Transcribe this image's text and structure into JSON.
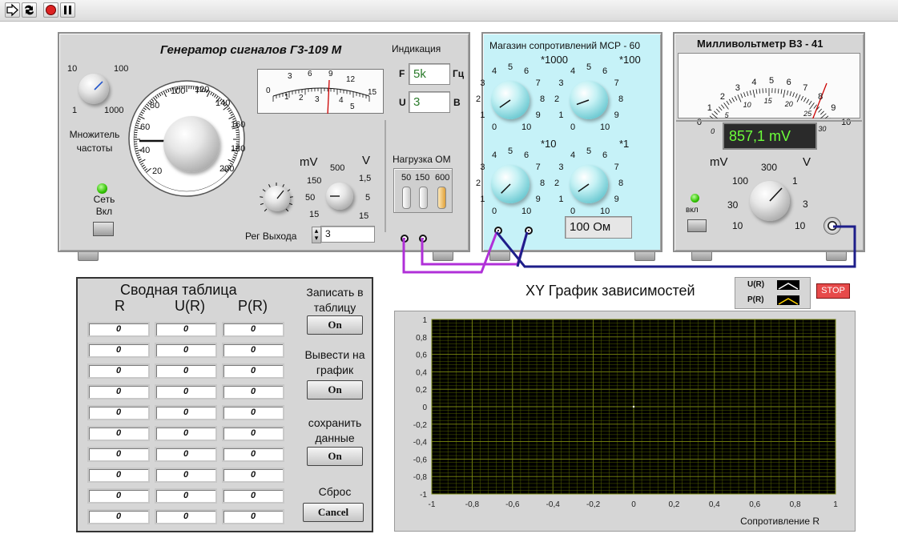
{
  "toolbar": {
    "icons": [
      "run-arrow-icon",
      "run-continuously-icon",
      "abort-icon",
      "pause-icon"
    ]
  },
  "generator": {
    "title": "Генератор сигналов Г3-109 М",
    "indication_label": "Индикация",
    "f_label": "F",
    "f_value": "5k",
    "f_unit": "Гц",
    "u_label": "U",
    "u_value": "3",
    "u_unit": "В",
    "multiplier_scale": [
      "10",
      "100",
      "1",
      "1000"
    ],
    "multiplier_label": "Множитель частоты",
    "dial_scale": [
      "20",
      "40",
      "60",
      "80",
      "100",
      "120",
      "140",
      "160",
      "180",
      "200"
    ],
    "power_label": "Сеть Вкл",
    "mv_label": "mV",
    "v_label": "V",
    "range_scale": [
      "500",
      "150",
      "50",
      "15",
      "1,5",
      "5",
      "15"
    ],
    "load_label": "Нагрузка ОМ",
    "load_options": [
      "50",
      "150",
      "600"
    ],
    "output_label": "Рег Выхода",
    "output_value": "3",
    "meter_top_scale": [
      "0",
      "3",
      "6",
      "9",
      "12"
    ],
    "meter_bottom_scale": [
      "0",
      "1",
      "2",
      "3",
      "4",
      "5",
      "15"
    ]
  },
  "resistance_box": {
    "title": "Магазин сопротивлений МСР - 60",
    "dials": [
      {
        "mult": "*1000"
      },
      {
        "mult": "*100"
      },
      {
        "mult": "*10"
      },
      {
        "mult": "*1"
      }
    ],
    "dial_scale": [
      "0",
      "1",
      "2",
      "3",
      "4",
      "5",
      "6",
      "7",
      "8",
      "9",
      "10"
    ],
    "value": "100 Ом"
  },
  "voltmeter": {
    "title": "Милливольтметр В3 - 41",
    "display": "857,1 mV",
    "mv_label": "mV",
    "v_label": "V",
    "range_scale": [
      "300",
      "100",
      "1",
      "30",
      "3",
      "10",
      "10"
    ],
    "power_label": "вкл",
    "meter_top_scale": [
      "0",
      "1",
      "2",
      "3",
      "4",
      "5",
      "6",
      "7",
      "8",
      "9",
      "10"
    ],
    "meter_bottom_scale": [
      "0",
      "5",
      "10",
      "15",
      "20",
      "25",
      "30"
    ]
  },
  "summary": {
    "title": "Сводная таблица",
    "columns": [
      "R",
      "U(R)",
      "P(R)"
    ],
    "rows": [
      [
        "0",
        "0",
        "0"
      ],
      [
        "0",
        "0",
        "0"
      ],
      [
        "0",
        "0",
        "0"
      ],
      [
        "0",
        "0",
        "0"
      ],
      [
        "0",
        "0",
        "0"
      ],
      [
        "0",
        "0",
        "0"
      ],
      [
        "0",
        "0",
        "0"
      ],
      [
        "0",
        "0",
        "0"
      ],
      [
        "0",
        "0",
        "0"
      ],
      [
        "0",
        "0",
        "0"
      ]
    ],
    "write_label": "Записать в таблицу",
    "write_btn": "On",
    "plot_label": "Вывести на график",
    "plot_btn": "On",
    "save_label": "сохранить данные",
    "save_btn": "On",
    "reset_label": "Сброс",
    "reset_btn": "Cancel"
  },
  "graph": {
    "title": "XY График зависимостей",
    "legend": [
      "U(R)",
      "P(R)"
    ],
    "stop_label": "STOP",
    "colors": {
      "plot_bg": "#000000",
      "grid": "#5a6a00",
      "grid_major": "#7c8a10",
      "ur_line": "#ffffff",
      "pr_line": "#ffd200"
    }
  },
  "chart_data": {
    "type": "scatter",
    "title": "XY График зависимостей",
    "xlabel": "Сопротивление R",
    "ylabel": "",
    "xlim": [
      -1,
      1
    ],
    "ylim": [
      -1,
      1
    ],
    "x_ticks": [
      "-1",
      "-0,8",
      "-0,6",
      "-0,4",
      "-0,2",
      "0",
      "0,2",
      "0,4",
      "0,6",
      "0,8",
      "1"
    ],
    "y_ticks": [
      "1",
      "0,8",
      "0,6",
      "0,4",
      "0,2",
      "0",
      "-0,2",
      "-0,4",
      "-0,6",
      "-0,8",
      "-1"
    ],
    "grid": true,
    "series": [
      {
        "name": "U(R)",
        "x": [
          0
        ],
        "y": [
          0
        ]
      },
      {
        "name": "P(R)",
        "x": [],
        "y": []
      }
    ]
  }
}
